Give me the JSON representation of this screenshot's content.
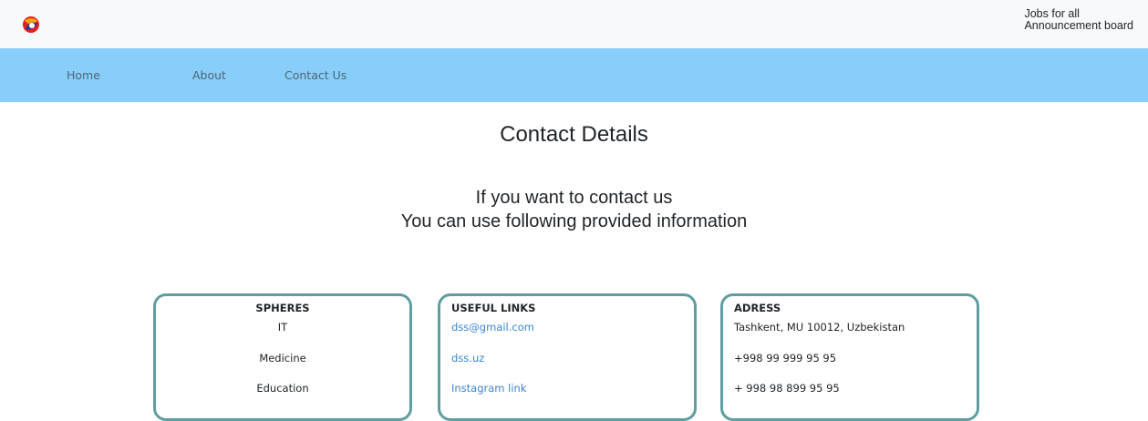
{
  "header": {
    "logo_icon": "brand-logo-icon",
    "brand_line1": "Jobs for all",
    "brand_line2": "Announcement board"
  },
  "nav": {
    "home": "Home",
    "about": "About",
    "contact": "Contact Us",
    "background_color": "#87cefa"
  },
  "main": {
    "title": "Contact Details",
    "subtitle_line1": "If you want to contact us",
    "subtitle_line2": "You can use following provided information"
  },
  "cards": {
    "spheres": {
      "title": "SPHERES",
      "items": [
        "IT",
        "Medicine",
        "Education"
      ]
    },
    "useful_links": {
      "title": "USEFUL LINKS",
      "items": [
        "dss@gmail.com",
        "dss.uz",
        "Instagram link"
      ]
    },
    "address": {
      "title": "ADRESS",
      "items": [
        "Tashkent, MU 10012, Uzbekistan",
        "+998 99 999 95 95",
        "+ 998 98 899 95 95"
      ]
    },
    "border_color": "#5f9ea0"
  }
}
